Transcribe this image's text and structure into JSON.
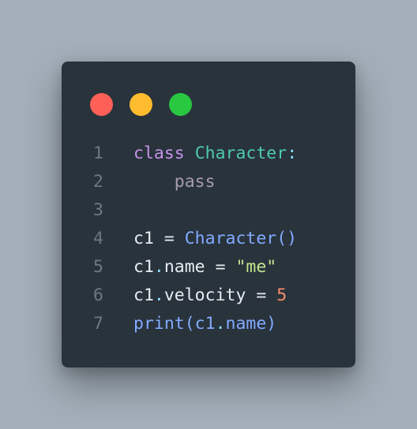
{
  "window": {
    "buttons": [
      {
        "name": "close",
        "color": "#fe5f57"
      },
      {
        "name": "minimize",
        "color": "#febc2e"
      },
      {
        "name": "maximize",
        "color": "#28c840"
      }
    ]
  },
  "code": {
    "lines": [
      {
        "number": "1",
        "tokens": [
          {
            "text": "class",
            "type": "keyword"
          },
          {
            "text": " ",
            "type": "default"
          },
          {
            "text": "Character",
            "type": "class"
          },
          {
            "text": ":",
            "type": "punct"
          }
        ]
      },
      {
        "number": "2",
        "tokens": [
          {
            "text": "    ",
            "type": "default"
          },
          {
            "text": "pass",
            "type": "pass"
          }
        ]
      },
      {
        "number": "3",
        "tokens": []
      },
      {
        "number": "4",
        "tokens": [
          {
            "text": "c1 = ",
            "type": "default"
          },
          {
            "text": "Character()",
            "type": "func"
          }
        ]
      },
      {
        "number": "5",
        "tokens": [
          {
            "text": "c1",
            "type": "default"
          },
          {
            "text": ".",
            "type": "punct"
          },
          {
            "text": "name = ",
            "type": "default"
          },
          {
            "text": "\"me\"",
            "type": "string"
          }
        ]
      },
      {
        "number": "6",
        "tokens": [
          {
            "text": "c1",
            "type": "default"
          },
          {
            "text": ".",
            "type": "punct"
          },
          {
            "text": "velocity = ",
            "type": "default"
          },
          {
            "text": "5",
            "type": "number"
          }
        ]
      },
      {
        "number": "7",
        "tokens": [
          {
            "text": "print(c1",
            "type": "func"
          },
          {
            "text": ".",
            "type": "punct"
          },
          {
            "text": "name)",
            "type": "func"
          }
        ]
      }
    ]
  }
}
